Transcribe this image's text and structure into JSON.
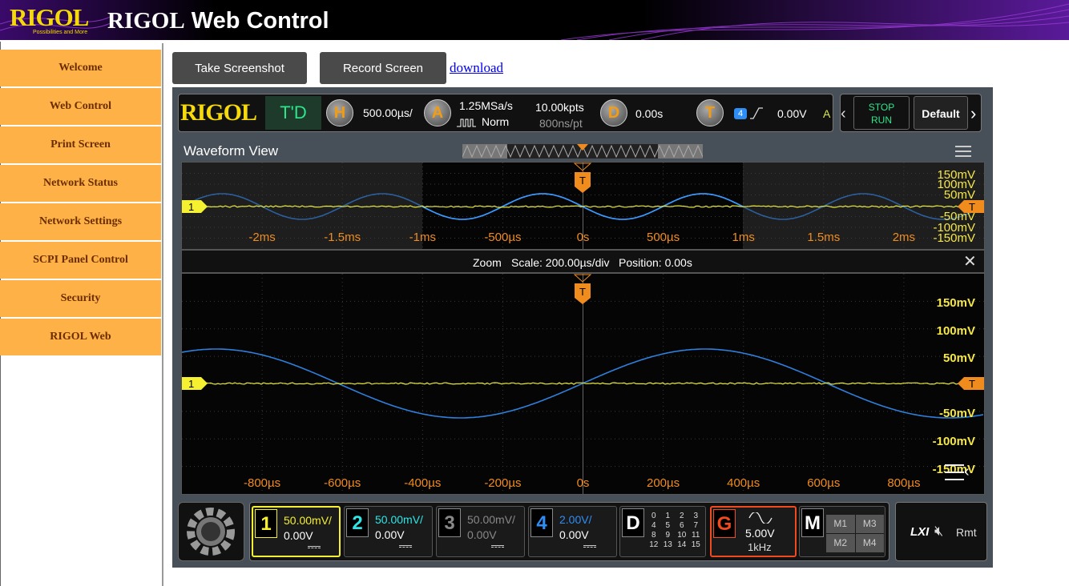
{
  "header": {
    "logo": "RIGOL",
    "logo_tagline": "Possibilities and More",
    "title_brand": "RIGOL",
    "title_rest": " Web Control"
  },
  "sidebar": {
    "items": [
      {
        "label": "Welcome"
      },
      {
        "label": "Web Control"
      },
      {
        "label": "Print Screen"
      },
      {
        "label": "Network Status"
      },
      {
        "label": "Network Settings"
      },
      {
        "label": "SCPI Panel Control"
      },
      {
        "label": "Security"
      },
      {
        "label": "RIGOL Web"
      }
    ]
  },
  "toolbar": {
    "screenshot_label": "Take Screenshot",
    "record_label": "Record Screen",
    "download_label": "download"
  },
  "scope": {
    "brand": "RIGOL",
    "mode": "T'D",
    "horizontal": {
      "letter": "H",
      "value": "500.00µs/"
    },
    "acquire": {
      "letter": "A",
      "rate": "1.25MSa/s",
      "mode": "Norm",
      "depth": "10.00kpts",
      "per_point": "800ns/pt"
    },
    "delay": {
      "letter": "D",
      "value": "0.00s"
    },
    "trigger": {
      "letter": "T",
      "channel": "4",
      "level": "0.00V",
      "state": "A"
    },
    "run": {
      "stop": "STOP",
      "run": "RUN"
    },
    "default": "Default",
    "waveform_title": "Waveform View",
    "main_x_labels": [
      "-2ms",
      "-1.5ms",
      "-1ms",
      "-500µs",
      "0s",
      "500µs",
      "1ms",
      "1.5ms",
      "2ms"
    ],
    "main_y_labels": [
      "150mV",
      "100mV",
      "50mV",
      "-50mV",
      "-100mV",
      "-150mV"
    ],
    "zoom_bar": {
      "zoom": "Zoom",
      "scale": "Scale: 200.00µs/div",
      "position": "Position: 0.00s"
    },
    "zoom_x_labels": [
      "-800µs",
      "-600µs",
      "-400µs",
      "-200µs",
      "0s",
      "200µs",
      "400µs",
      "600µs",
      "800µs"
    ],
    "zoom_y_labels": [
      "150mV",
      "100mV",
      "50mV",
      "-50mV",
      "-100mV",
      "-150mV"
    ],
    "trig_marker": "T",
    "ch_marker": "1",
    "channels": [
      {
        "num": "1",
        "scale": "50.00mV/",
        "offset": "0.00V",
        "color": "#f5f030"
      },
      {
        "num": "2",
        "scale": "50.00mV/",
        "offset": "0.00V",
        "color": "#2ee6e6"
      },
      {
        "num": "3",
        "scale": "50.00mV/",
        "offset": "0.00V",
        "color": "#888888"
      },
      {
        "num": "4",
        "scale": "2.00V/",
        "offset": "0.00V",
        "color": "#2f8ef5"
      }
    ],
    "digital": {
      "letter": "D",
      "bits": [
        "0",
        "1",
        "2",
        "3",
        "4",
        "5",
        "6",
        "7",
        "8",
        "9",
        "10",
        "11",
        "12",
        "13",
        "14",
        "15"
      ]
    },
    "generator": {
      "letter": "G",
      "value": "5.00V",
      "freq": "1kHz"
    },
    "math": {
      "letter": "M",
      "items": [
        "M1",
        "M3",
        "M2",
        "M4"
      ]
    },
    "status": {
      "lxi": "LXI",
      "rmt": "Rmt"
    }
  },
  "colors": {
    "sidebar": "#fdb147",
    "ch1": "#f5f030",
    "ch4": "#2f8ef5",
    "trigger": "#f08c1e"
  }
}
